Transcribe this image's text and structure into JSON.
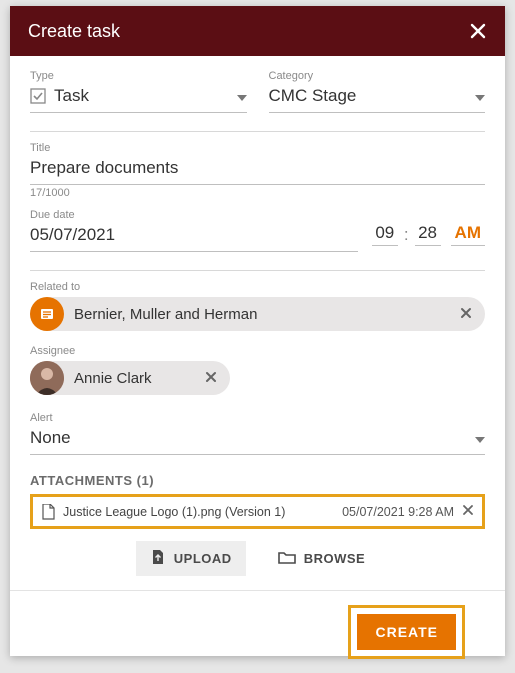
{
  "header": {
    "title": "Create task"
  },
  "type": {
    "label": "Type",
    "value": "Task"
  },
  "category": {
    "label": "Category",
    "value": "CMC Stage"
  },
  "titleField": {
    "label": "Title",
    "value": "Prepare documents",
    "counter": "17/1000"
  },
  "dueDate": {
    "label": "Due date",
    "value": "05/07/2021",
    "hh": "09",
    "mm": "28",
    "ampm": "AM"
  },
  "relatedTo": {
    "label": "Related to",
    "chip": "Bernier, Muller and Herman"
  },
  "assignee": {
    "label": "Assignee",
    "chip": "Annie Clark"
  },
  "alert": {
    "label": "Alert",
    "value": "None"
  },
  "attachments": {
    "headerPrefix": "ATTACHMENTS",
    "count": "(1)",
    "file": "Justice League Logo (1).png (Version 1)",
    "date": "05/07/2021 9:28 AM"
  },
  "buttons": {
    "upload": "UPLOAD",
    "browse": "BROWSE",
    "create": "CREATE"
  }
}
